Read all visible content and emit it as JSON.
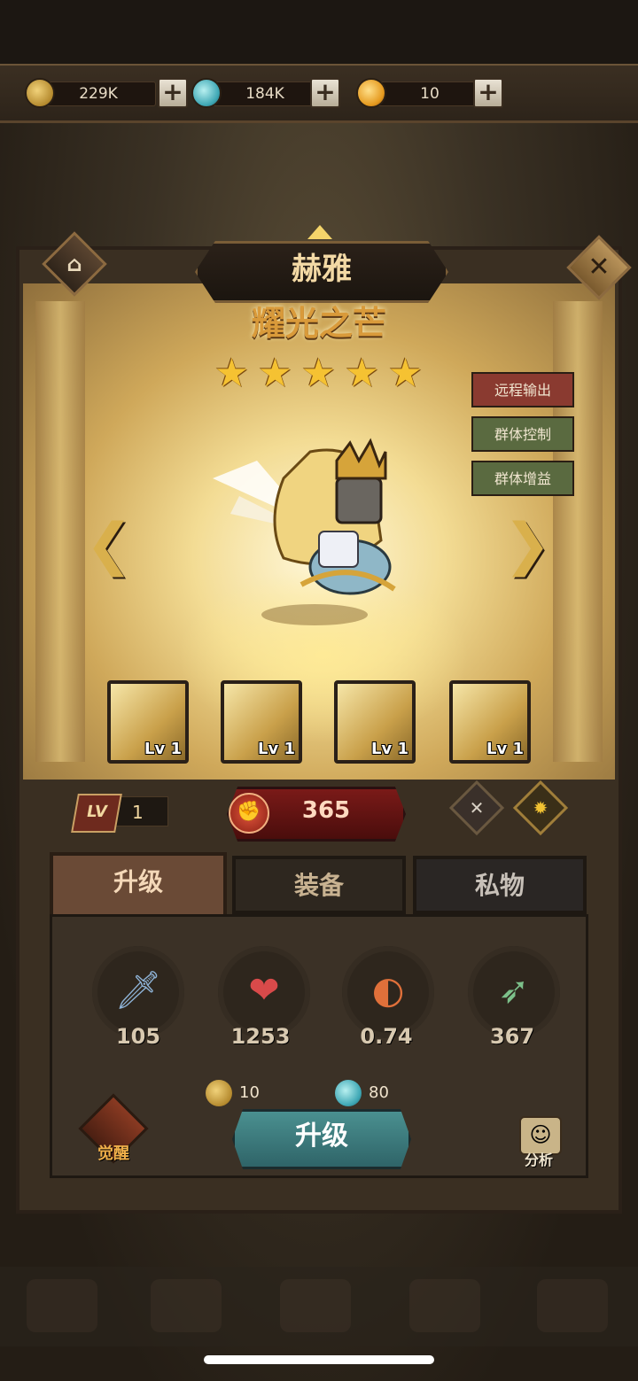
{
  "resources": [
    {
      "name": "gold",
      "value": "229K"
    },
    {
      "name": "gem",
      "value": "184K"
    },
    {
      "name": "orb",
      "value": "10"
    }
  ],
  "hero": {
    "name": "赫雅",
    "title": "耀光之芒",
    "stars": 5,
    "tags": [
      "远程输出",
      "群体控制",
      "群体增益"
    ],
    "skills": [
      {
        "level": "Lv 1"
      },
      {
        "level": "Lv 1"
      },
      {
        "level": "Lv 1"
      },
      {
        "level": "Lv 1"
      }
    ],
    "lv_label": "LV",
    "level": "1",
    "power": "365"
  },
  "tabs": [
    "升级",
    "装备",
    "私物"
  ],
  "stats": [
    {
      "name": "attack",
      "icon": "sword-icon",
      "value": "105"
    },
    {
      "name": "hp",
      "icon": "heart-icon",
      "value": "1253"
    },
    {
      "name": "attack-speed",
      "icon": "bow-icon",
      "value": "0.74"
    },
    {
      "name": "range",
      "icon": "arrow-icon",
      "value": "367"
    }
  ],
  "upgrade": {
    "cost_gold": "10",
    "cost_gem": "80",
    "button_label": "升级",
    "awaken_label": "觉醒",
    "analysis_label": "分析"
  },
  "colors": {
    "accent": "#d99a3a",
    "power_red": "#7a1a18",
    "teal_button": "#3f7f82"
  }
}
